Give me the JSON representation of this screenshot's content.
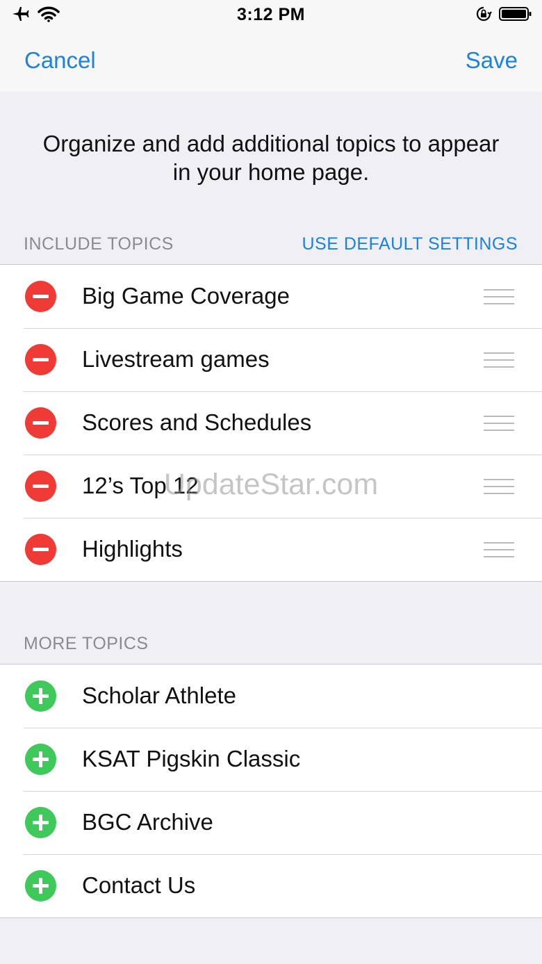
{
  "status_bar": {
    "time": "3:12 PM",
    "icons": [
      "airplane-icon",
      "wifi-icon",
      "orientation-lock-icon",
      "battery-icon"
    ]
  },
  "nav": {
    "cancel_label": "Cancel",
    "save_label": "Save"
  },
  "intro_text": "Organize and add additional topics to appear in your home page.",
  "include_section": {
    "header": "INCLUDE TOPICS",
    "action_label": "USE DEFAULT SETTINGS",
    "items": [
      {
        "label": "Big Game Coverage"
      },
      {
        "label": "Livestream games"
      },
      {
        "label": "Scores and Schedules"
      },
      {
        "label": "12’s Top 12"
      },
      {
        "label": "Highlights"
      }
    ]
  },
  "more_section": {
    "header": "MORE TOPICS",
    "items": [
      {
        "label": "Scholar Athlete"
      },
      {
        "label": "KSAT Pigskin Classic"
      },
      {
        "label": "BGC Archive"
      },
      {
        "label": "Contact Us"
      }
    ]
  },
  "watermark": "UpdateStar.com",
  "colors": {
    "accent": "#1a82e2",
    "remove": "#f03a36",
    "add": "#3fc95a",
    "background": "#efeff4"
  }
}
